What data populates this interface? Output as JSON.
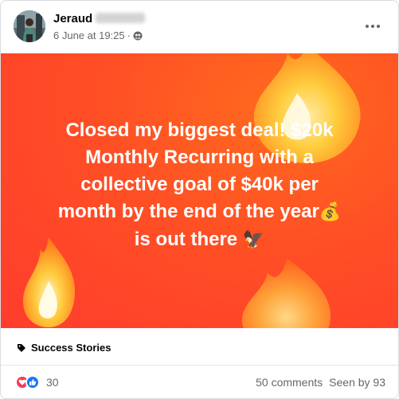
{
  "post": {
    "author_name": "Jeraud",
    "date": "6 June at 19:25",
    "separator": "·",
    "privacy_icon": "friends-globe-icon",
    "more_icon": "more-options-icon"
  },
  "banner": {
    "line1": "Closed my biggest deal! $20k",
    "line2": "Monthly Recurring with a",
    "line3": "collective goal of $40k per",
    "line4": "month by the end of the year",
    "line4_emoji": "💰",
    "line5": "is out there",
    "line5_emoji": "🦅",
    "background_color": "#ff4f25",
    "decoration": "fire-emoji-icons"
  },
  "tag": {
    "icon": "tag-icon",
    "label": "Success Stories"
  },
  "footer": {
    "reactions": [
      "love-reaction-icon",
      "like-reaction-icon"
    ],
    "reaction_count": "30",
    "comments": "50 comments",
    "seen_by": "Seen by 93"
  }
}
